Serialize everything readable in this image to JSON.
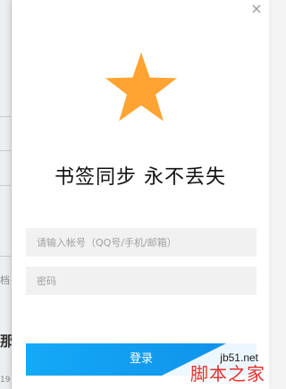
{
  "backdrop": {
    "snippets": [
      "档",
      "那",
      "19"
    ]
  },
  "panel": {
    "close_symbol": "×",
    "title": "书签同步  永不丢失",
    "icons": {
      "star": "star-icon",
      "star_color": "#ffa332"
    },
    "account": {
      "placeholder": "请输入帐号（QQ号/手机/邮箱）",
      "value": ""
    },
    "password": {
      "placeholder": "密码",
      "value": ""
    },
    "login_label": "登录",
    "accent_color": "#14a9f7"
  },
  "watermark": {
    "url": "jb51.net",
    "name": "脚本之家"
  }
}
